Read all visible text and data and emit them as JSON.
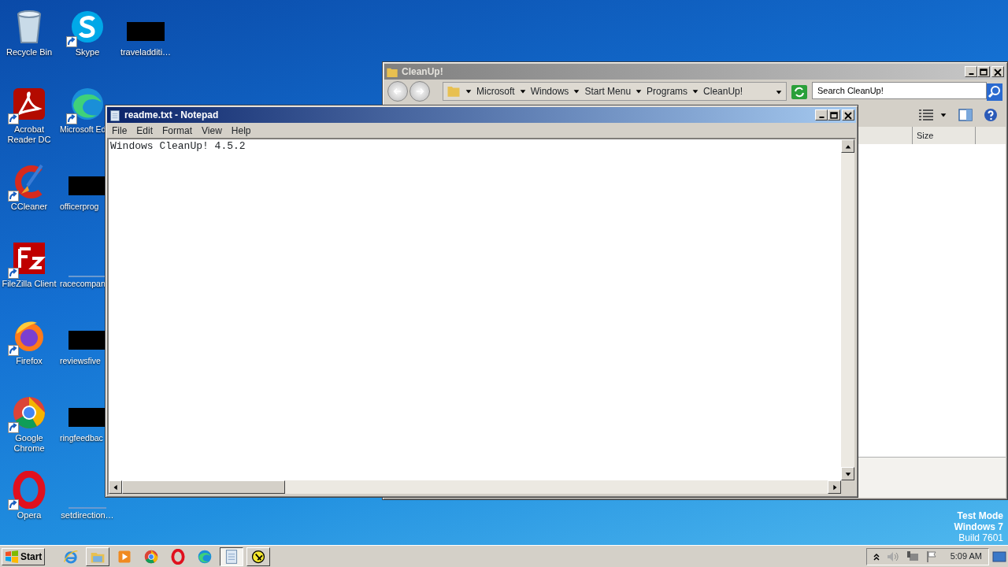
{
  "desktop_icons": [
    {
      "label": "Recycle Bin",
      "kind": "recycle-bin",
      "shortcut": false
    },
    {
      "label": "Acrobat Reader DC",
      "kind": "acrobat",
      "shortcut": true
    },
    {
      "label": "CCleaner",
      "kind": "ccleaner",
      "shortcut": true
    },
    {
      "label": "FileZilla Client",
      "kind": "filezilla",
      "shortcut": true
    },
    {
      "label": "Firefox",
      "kind": "firefox",
      "shortcut": true
    },
    {
      "label": "Google Chrome",
      "kind": "chrome",
      "shortcut": true
    },
    {
      "label": "Opera",
      "kind": "opera",
      "shortcut": true
    },
    {
      "label": "Skype",
      "kind": "skype",
      "shortcut": true
    },
    {
      "label": "Microsoft Ed",
      "kind": "edge",
      "shortcut": true
    },
    {
      "label": "officerprog",
      "kind": "redacted",
      "shortcut": false
    },
    {
      "label": "racecompan",
      "kind": "blank",
      "shortcut": false
    },
    {
      "label": "reviewsfive",
      "kind": "redacted",
      "shortcut": false
    },
    {
      "label": "ringfeedbac",
      "kind": "redacted",
      "shortcut": false
    },
    {
      "label": "setdirection…",
      "kind": "blank",
      "shortcut": false
    },
    {
      "label": "traveladditi…",
      "kind": "redacted",
      "shortcut": false
    }
  ],
  "explorer": {
    "title": "CleanUp!",
    "breadcrumbs": [
      "Microsoft",
      "Windows",
      "Start Menu",
      "Programs",
      "CleanUp!"
    ],
    "search": {
      "placeholder": "Search CleanUp!"
    },
    "columns": [
      "Size"
    ]
  },
  "notepad": {
    "title": "readme.txt - Notepad",
    "menu": [
      "File",
      "Edit",
      "Format",
      "View",
      "Help"
    ],
    "text": "Windows CleanUp! 4.5.2"
  },
  "test_mode": [
    "Test Mode",
    "Windows 7",
    "Build 7601"
  ],
  "taskbar": {
    "start": "Start",
    "items": [
      {
        "kind": "ie",
        "open": false,
        "selected": false
      },
      {
        "kind": "explorer",
        "open": true,
        "selected": false
      },
      {
        "kind": "media",
        "open": false,
        "selected": false
      },
      {
        "kind": "chrome",
        "open": false,
        "selected": false
      },
      {
        "kind": "opera",
        "open": false,
        "selected": false
      },
      {
        "kind": "edge",
        "open": false,
        "selected": false
      },
      {
        "kind": "notepad",
        "open": true,
        "selected": true
      },
      {
        "kind": "cleanup",
        "open": true,
        "selected": false
      }
    ],
    "clock": "5:09 AM"
  }
}
